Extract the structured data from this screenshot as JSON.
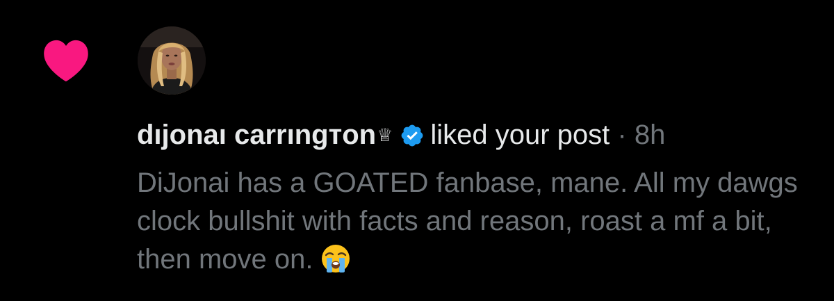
{
  "notification": {
    "icon": "heart-icon",
    "icon_color": "#f91880",
    "avatar": "profile-photo",
    "author_name": "dıjonaı carrıngтon",
    "author_badge": "♕",
    "verified": true,
    "verified_color": "#1d9bf0",
    "action_text": "liked your post",
    "separator": "·",
    "timestamp": "8h",
    "post_text": "DiJonai has a GOATED fanbase, mane. All my dawgs clock bullshit with facts and reason, roast a mf a bit, then move on.",
    "post_emoji": "loudly-crying-face"
  }
}
